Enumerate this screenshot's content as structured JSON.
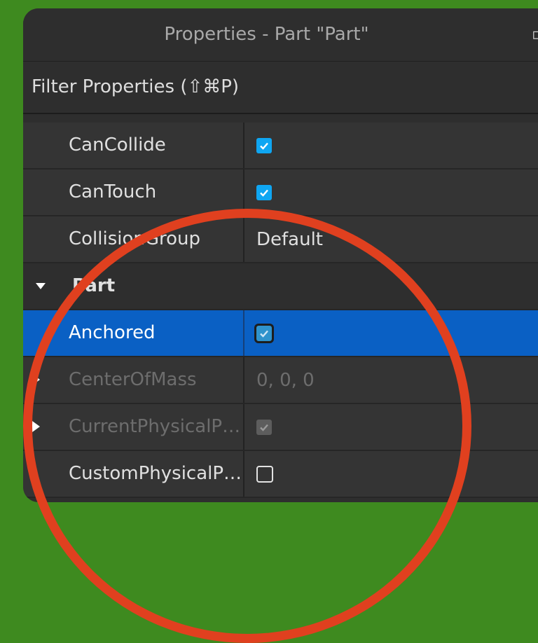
{
  "title": "Properties - Part \"Part\"",
  "filter_label": "Filter Properties (⇧⌘P)",
  "rows": [
    {
      "name": "CanCollide",
      "value_type": "checkbox",
      "checked": true
    },
    {
      "name": "CanTouch",
      "value_type": "checkbox",
      "checked": true
    },
    {
      "name": "CollisionGroup",
      "value": "Default"
    },
    {
      "section": "Part"
    },
    {
      "name": "Anchored",
      "value_type": "checkbox",
      "checked": true,
      "selected": true
    },
    {
      "name": "CenterOfMass",
      "value": "0, 0, 0",
      "expandable": true,
      "disabled": true
    },
    {
      "name": "CurrentPhysicalP…",
      "value_type": "checkbox",
      "checked": true,
      "expandable": true,
      "disabled": true
    },
    {
      "name": "CustomPhysicalP…",
      "value_type": "checkbox",
      "checked": false
    }
  ],
  "colors": {
    "background": "#3e8a1f",
    "highlight_circle": "#e0401f",
    "selection": "#0a60c4",
    "checkbox": "#0fa6f2"
  }
}
